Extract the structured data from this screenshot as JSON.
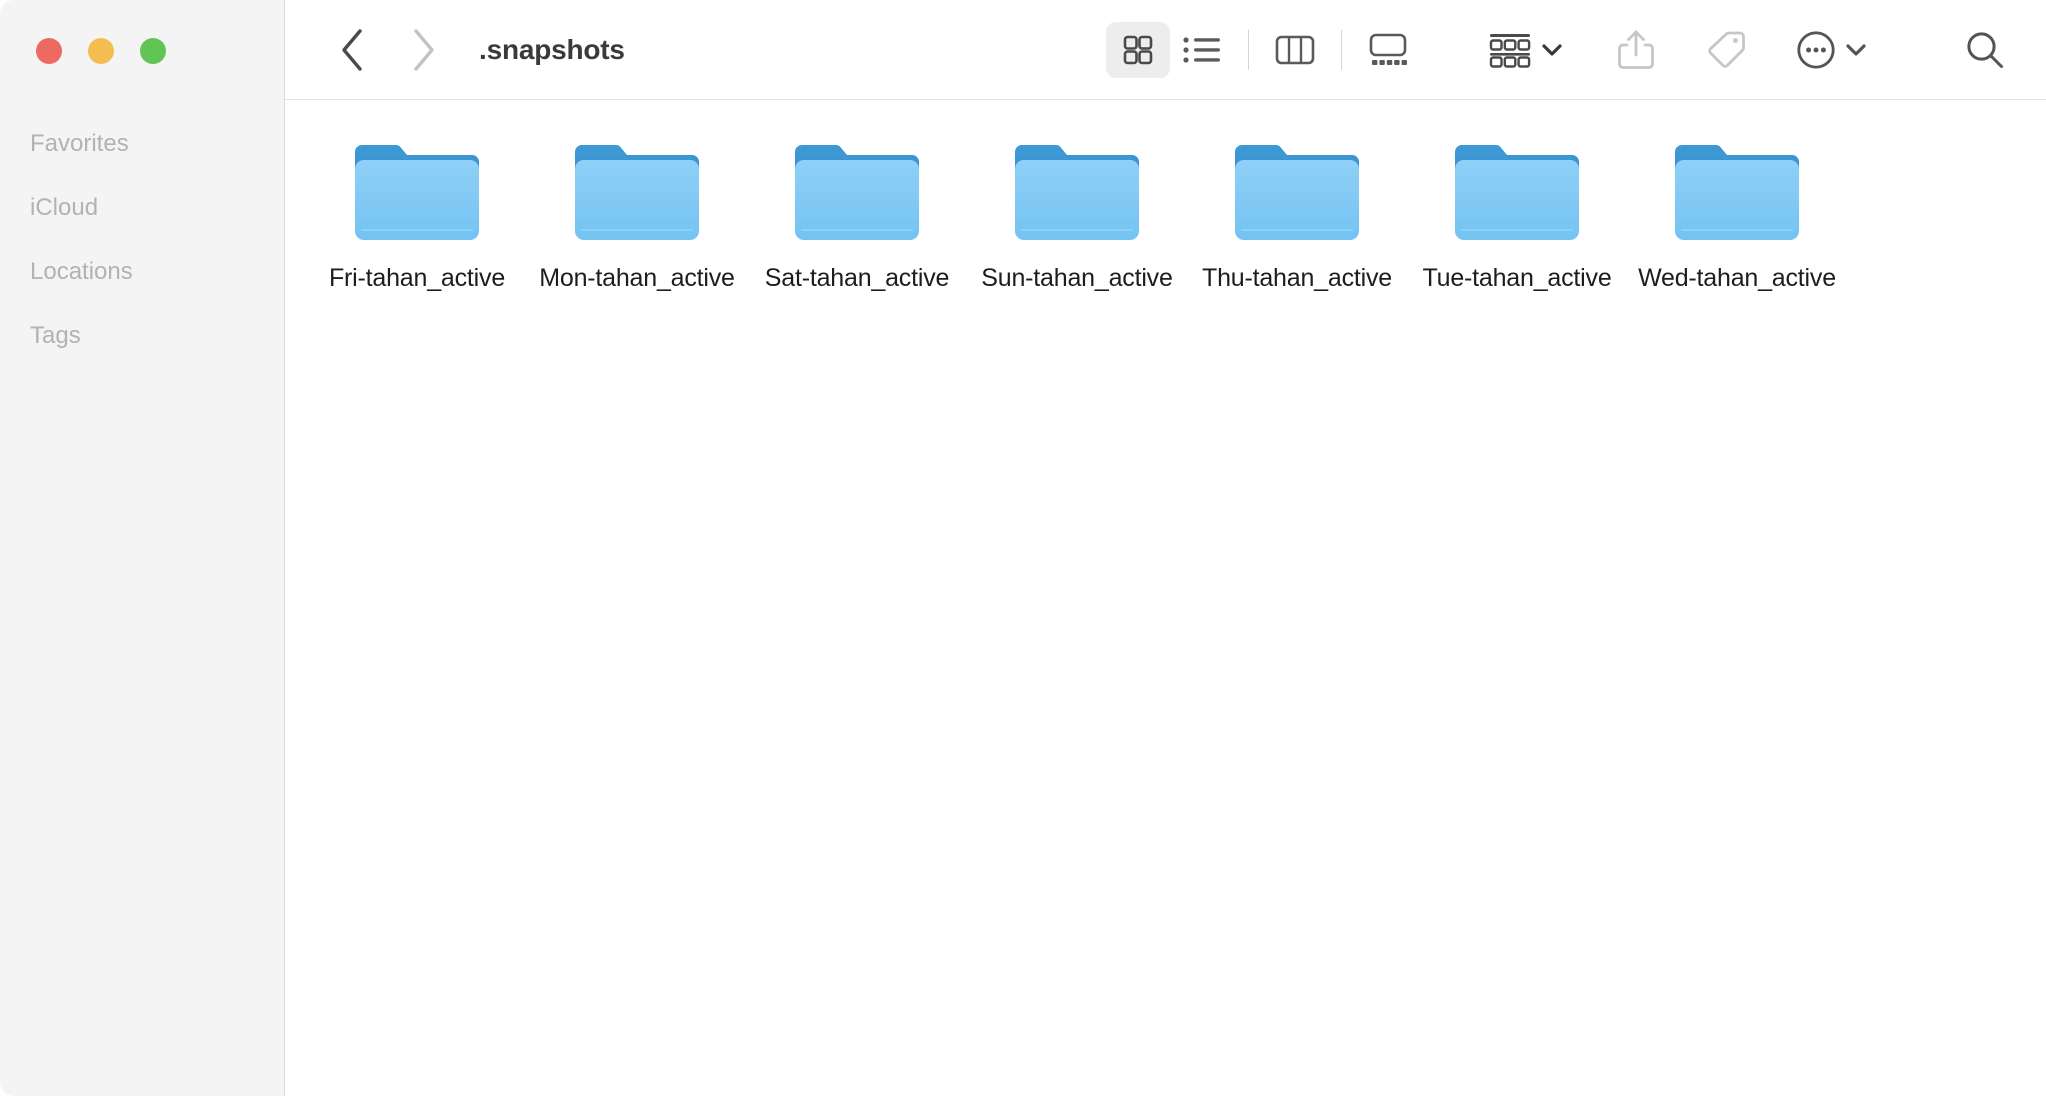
{
  "window": {
    "title": ".snapshots",
    "traffic_lights": [
      {
        "name": "close",
        "color": "#ec6a5f"
      },
      {
        "name": "minimize",
        "color": "#f4bd50"
      },
      {
        "name": "zoom",
        "color": "#61c555"
      }
    ]
  },
  "sidebar": {
    "sections": [
      {
        "label": "Favorites"
      },
      {
        "label": "iCloud"
      },
      {
        "label": "Locations"
      },
      {
        "label": "Tags"
      }
    ]
  },
  "toolbar": {
    "back_icon": "chevron-left-icon",
    "forward_icon": "chevron-right-icon",
    "back_enabled": true,
    "forward_enabled": false,
    "view_modes": [
      {
        "id": "icon",
        "icon": "grid-view-icon",
        "label": "as Icons",
        "selected": true
      },
      {
        "id": "list",
        "icon": "list-view-icon",
        "label": "as List",
        "selected": false
      },
      {
        "id": "column",
        "icon": "column-view-icon",
        "label": "as Columns",
        "selected": false
      },
      {
        "id": "gallery",
        "icon": "gallery-view-icon",
        "label": "as Gallery",
        "selected": false
      }
    ],
    "actions": [
      {
        "id": "group",
        "icon": "group-by-icon",
        "label": "Group",
        "has_chevron": true,
        "enabled": true
      },
      {
        "id": "share",
        "icon": "share-icon",
        "label": "Share",
        "has_chevron": false,
        "enabled": false
      },
      {
        "id": "tags",
        "icon": "tag-icon",
        "label": "Tags",
        "has_chevron": false,
        "enabled": false
      },
      {
        "id": "more",
        "icon": "ellipsis-circle-icon",
        "label": "More",
        "has_chevron": true,
        "enabled": true
      }
    ],
    "search": {
      "icon": "search-icon",
      "label": "Search"
    }
  },
  "content": {
    "view": "icon",
    "items": [
      {
        "name": "Fri-tahan_active",
        "kind": "folder"
      },
      {
        "name": "Mon-tahan_active",
        "kind": "folder"
      },
      {
        "name": "Sat-tahan_active",
        "kind": "folder"
      },
      {
        "name": "Sun-tahan_active",
        "kind": "folder"
      },
      {
        "name": "Thu-tahan_active",
        "kind": "folder"
      },
      {
        "name": "Tue-tahan_active",
        "kind": "folder"
      },
      {
        "name": "Wed-tahan_active",
        "kind": "folder"
      }
    ]
  },
  "colors": {
    "sidebar_bg": "#f4f4f5",
    "content_bg": "#ffffff",
    "folder_tab": "#3a92cf",
    "folder_body_top": "#8fd0f7",
    "folder_body_bottom": "#74c3f2",
    "label_text": "#1d1d1f",
    "section_text": "#b2b2b4",
    "title_text": "#3a3a3c",
    "selected_btn_bg": "#ededed"
  }
}
